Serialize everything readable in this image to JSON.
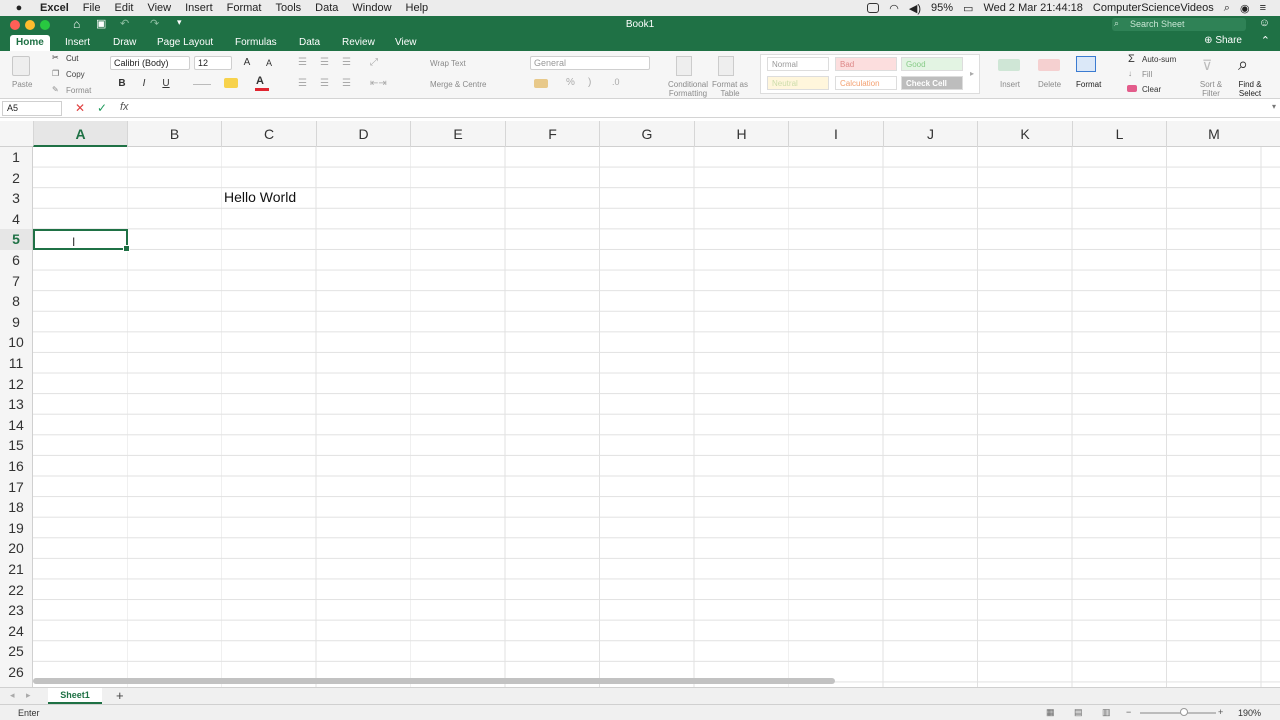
{
  "menubar": {
    "app": "Excel",
    "items": [
      "File",
      "Edit",
      "View",
      "Insert",
      "Format",
      "Tools",
      "Data",
      "Window",
      "Help"
    ],
    "battery": "95%",
    "datetime": "Wed 2 Mar  21:44:18",
    "user": "ComputerScienceVideos"
  },
  "window": {
    "title": "Book1",
    "search_placeholder": "Search Sheet"
  },
  "tabs": {
    "items": [
      "Home",
      "Insert",
      "Draw",
      "Page Layout",
      "Formulas",
      "Data",
      "Review",
      "View"
    ],
    "share": "Share"
  },
  "ribbon": {
    "clipboard": {
      "paste": "Paste",
      "cut": "Cut",
      "copy": "Copy",
      "format": "Format"
    },
    "font": {
      "name": "Calibri (Body)",
      "size": "12",
      "bold": "B",
      "italic": "I",
      "underline": "U",
      "grow": "A",
      "shrink": "A"
    },
    "alignment": {
      "wrap": "Wrap Text",
      "merge": "Merge & Centre"
    },
    "number": {
      "format": "General",
      "percent": "%"
    },
    "conditional": "Conditional Formatting",
    "format_table": "Format as Table",
    "styles": [
      "Normal",
      "Bad",
      "Good",
      "Neutral",
      "Calculation",
      "Check Cell"
    ],
    "cells": {
      "insert": "Insert",
      "delete": "Delete",
      "format": "Format"
    },
    "editing": {
      "autosum": "Auto-sum",
      "fill": "Fill",
      "clear": "Clear",
      "sort": "Sort & Filter",
      "find": "Find & Select"
    }
  },
  "formula_bar": {
    "name_box": "A5",
    "fx": "fx",
    "value": ""
  },
  "grid": {
    "columns": [
      "A",
      "B",
      "C",
      "D",
      "E",
      "F",
      "G",
      "H",
      "I",
      "J",
      "K",
      "L",
      "M"
    ],
    "selected_column": "A",
    "selected_row": "5",
    "rows": [
      "1",
      "2",
      "3",
      "4",
      "5",
      "6",
      "7",
      "8",
      "9",
      "10",
      "11",
      "12",
      "13",
      "14",
      "15",
      "16",
      "17",
      "18",
      "19",
      "20",
      "21",
      "22",
      "23",
      "24",
      "25",
      "26"
    ],
    "cells": {
      "C3": "Hello World"
    }
  },
  "sheets": {
    "active": "Sheet1",
    "add": "+"
  },
  "status": {
    "mode": "Enter",
    "zoom": "190%"
  },
  "colors": {
    "accent": "#1f7145"
  }
}
